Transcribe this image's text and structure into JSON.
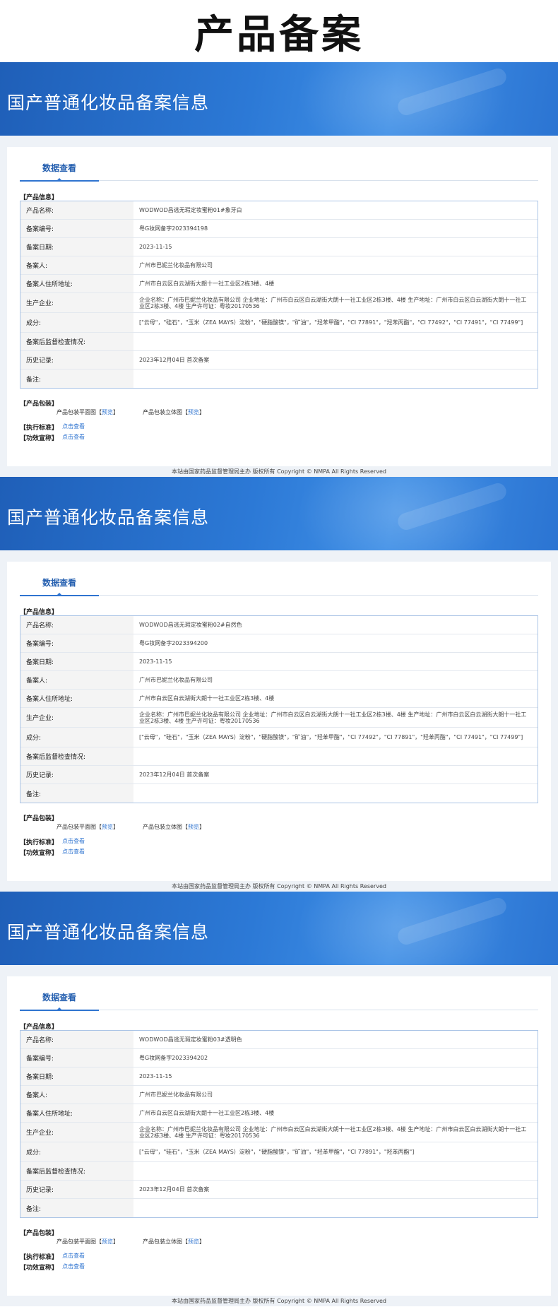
{
  "page_title": "产品备案",
  "banner_title": "国产普通化妆品备案信息",
  "tab_label": "数据查看",
  "labels": {
    "product_info": "【产品信息】",
    "name": "产品名称:",
    "reg_no": "备案编号:",
    "reg_date": "备案日期:",
    "applicant": "备案人:",
    "applicant_addr": "备案人住所地址:",
    "manufacturer": "生产企业:",
    "ingredients": "成分:",
    "inspection": "备案后监督检查情况:",
    "history": "历史记录:",
    "remarks": "备注:",
    "package": "【产品包装】",
    "pkg_flat": "产品包装平面图",
    "pkg_3d": "产品包装立体图",
    "preview": "预览",
    "lb": "【",
    "rb": "】",
    "standard": "【执行标准】",
    "efficacy": "【功效宣称】",
    "click_view": "点击查看"
  },
  "footer": "本站由国家药品监督管理局主办 版权所有 Copyright © NMPA All Rights Reserved",
  "records": [
    {
      "name": "WODWOD昌逃无瑕定妆蜜粉01#象牙白",
      "reg_no": "粤G妆网备字2023394198",
      "reg_date": "2023-11-15",
      "applicant": "广州市巴妮兰化妆品有限公司",
      "applicant_addr": "广州市白云区白云湖街大朗十一社工业区2栋3楼、4楼",
      "manufacturer": "企业名称：广州市巴妮兰化妆品有限公司 企业地址：广州市白云区白云湖街大朗十一社工业区2栋3楼、4楼 生产地址：广州市白云区白云湖街大朗十一社工业区2栋3楼、4楼 生产许可证：粤妆20170536",
      "ingredients": "[\"云母\"，\"硅石\"，\"玉米（ZEA MAYS）淀粉\"，\"硬脂酸镁\"，\"矿油\"，\"羟苯甲酯\"，\"CI 77891\"，\"羟苯丙酯\"，\"CI 77492\"，\"CI 77491\"，\"CI 77499\"]",
      "inspection": "",
      "history": "2023年12月04日 首次备案",
      "remarks": ""
    },
    {
      "name": "WODWOD昌逃无瑕定妆蜜粉02#自然色",
      "reg_no": "粤G妆网备字2023394200",
      "reg_date": "2023-11-15",
      "applicant": "广州市巴妮兰化妆品有限公司",
      "applicant_addr": "广州市白云区白云湖街大朗十一社工业区2栋3楼、4楼",
      "manufacturer": "企业名称：广州市巴妮兰化妆品有限公司 企业地址：广州市白云区白云湖街大朗十一社工业区2栋3楼、4楼 生产地址：广州市白云区白云湖街大朗十一社工业区2栋3楼、4楼 生产许可证：粤妆20170536",
      "ingredients": "[\"云母\"，\"硅石\"，\"玉米（ZEA MAYS）淀粉\"，\"硬脂酸镁\"，\"矿油\"，\"羟苯甲酯\"，\"CI 77492\"，\"CI 77891\"，\"羟苯丙酯\"，\"CI 77491\"，\"CI 77499\"]",
      "inspection": "",
      "history": "2023年12月04日 首次备案",
      "remarks": ""
    },
    {
      "name": "WODWOD昌逃无瑕定妆蜜粉03#透明色",
      "reg_no": "粤G妆网备字2023394202",
      "reg_date": "2023-11-15",
      "applicant": "广州市巴妮兰化妆品有限公司",
      "applicant_addr": "广州市白云区白云湖街大朗十一社工业区2栋3楼、4楼",
      "manufacturer": "企业名称：广州市巴妮兰化妆品有限公司 企业地址：广州市白云区白云湖街大朗十一社工业区2栋3楼、4楼 生产地址：广州市白云区白云湖街大朗十一社工业区2栋3楼、4楼 生产许可证：粤妆20170536",
      "ingredients": "[\"云母\"，\"硅石\"，\"玉米（ZEA MAYS）淀粉\"，\"硬脂酸镁\"，\"矿油\"，\"羟苯甲酯\"，\"CI 77891\"，\"羟苯丙酯\"]",
      "inspection": "",
      "history": "2023年12月04日 首次备案",
      "remarks": ""
    }
  ]
}
